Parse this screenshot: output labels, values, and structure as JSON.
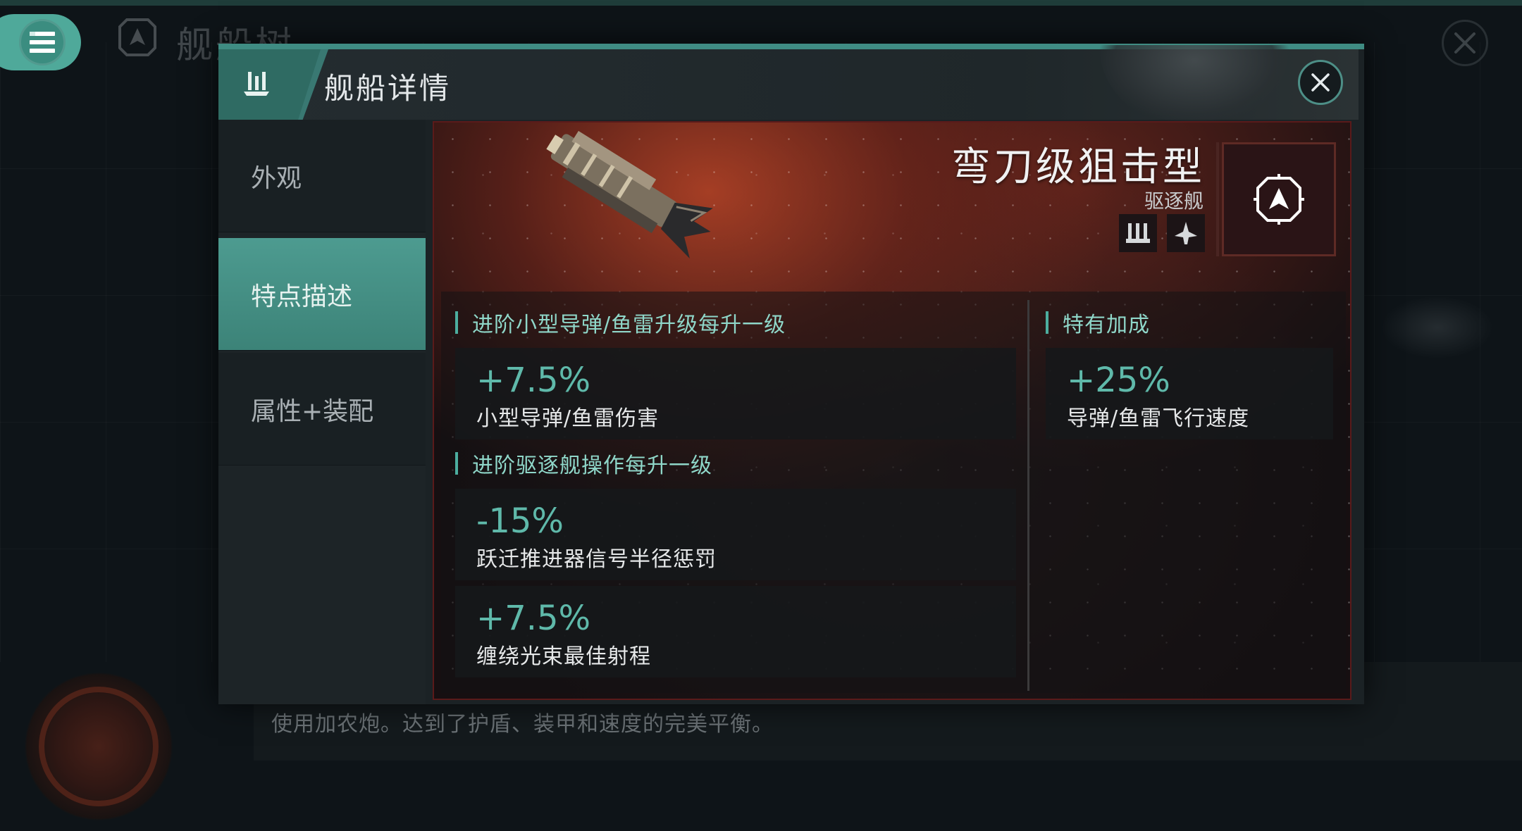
{
  "background": {
    "page_title": "舰船树",
    "bottom_description": "使用加农炮。达到了护盾、装甲和速度的完美平衡。"
  },
  "modal": {
    "title": "舰船详情",
    "tabs": [
      {
        "label": "外观",
        "active": false
      },
      {
        "label": "特点描述",
        "active": true
      },
      {
        "label": "属性+装配",
        "active": false
      }
    ]
  },
  "ship": {
    "name": "弯刀级狙击型",
    "class": "驱逐舰",
    "role_icons": [
      "missile-launcher-icon",
      "frigate-icon"
    ],
    "faction_icon": "faction-emblem-icon"
  },
  "bonuses": {
    "sections": [
      {
        "title": "进阶小型导弹/鱼雷升级每升一级",
        "items": [
          {
            "value": "+7.5%",
            "desc": "小型导弹/鱼雷伤害"
          }
        ]
      },
      {
        "title": "进阶驱逐舰操作每升一级",
        "items": [
          {
            "value": "-15%",
            "desc": "跃迁推进器信号半径惩罚"
          },
          {
            "value": "+7.5%",
            "desc": "缠绕光束最佳射程"
          }
        ]
      },
      {
        "title": "特有加成",
        "items": [
          {
            "value": "+25%",
            "desc": "导弹/鱼雷飞行速度"
          }
        ]
      }
    ]
  },
  "colors": {
    "accent": "#4fa99a",
    "bonus_value": "#5fb9aa",
    "section_title": "#8fd7c9"
  }
}
